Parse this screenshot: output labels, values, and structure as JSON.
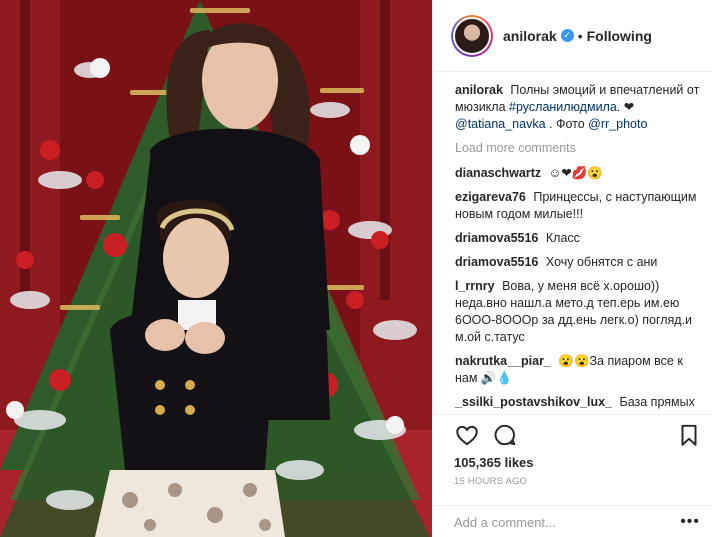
{
  "post": {
    "author": "anilorak",
    "follow_status": "Following",
    "separator": "•",
    "verified_mark": "✓"
  },
  "caption": {
    "user": "anilorak",
    "text": "Полны эмоций и впечатлений от мюзикла",
    "hashtag": "#русланилюдмила",
    "heart": ". ❤",
    "mention1": "@tatiana_navka",
    "photo_by": ". Фото",
    "mention2": "@rr_photo"
  },
  "load_more": "Load more comments",
  "comments": [
    {
      "user": "dianaschwartz",
      "text": "☺❤💋😮"
    },
    {
      "user": "ezigareva76",
      "text": "Принцессы, с наступающим новым годом милые!!!"
    },
    {
      "user": "driamova5516",
      "text": "Класс"
    },
    {
      "user": "driamova5516",
      "text": "Хочу обнятся с ани"
    },
    {
      "user": "l_rrnry",
      "text": "Вова, у меня всё х.орошо)) неда.вно нашл.а мето.д теп.ерь им.ею 6ООО-8ОООр за дд.ень легк.о) погляд.и м.ой с.татус"
    },
    {
      "user": "nakrutka__piar_",
      "text": "😮😮За пиаром все к нам 🔊💧"
    },
    {
      "user": "_ssilki_postavshikov_lux_",
      "text": "База прямых поставщиков"
    }
  ],
  "likes": "105,365 likes",
  "timestamp": "15 HOURS AGO",
  "add_comment_placeholder": "Add a comment...",
  "more_label": "•••",
  "icons": {
    "avatar": "avatar",
    "verified": "verified-badge-icon",
    "like": "heart-icon",
    "comment": "comment-bubble-icon",
    "save": "bookmark-icon",
    "more": "more-options-icon"
  },
  "colors": {
    "link": "#003569",
    "muted": "#999999",
    "verified": "#3897f0",
    "border": "#efefef"
  }
}
